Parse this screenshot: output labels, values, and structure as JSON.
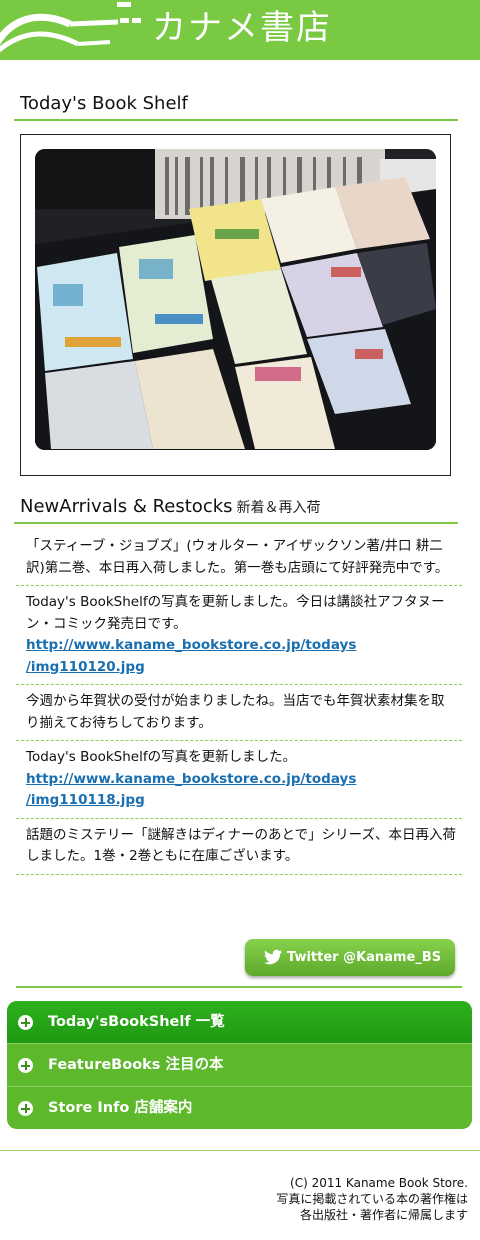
{
  "header": {
    "store_name": "カナメ書店",
    "logo_icon": "open-book-logo-icon",
    "brand_color": "#7ac943"
  },
  "todays_shelf": {
    "title": "Today's Book Shelf",
    "photo_icon": "book-shelf-photo"
  },
  "new_arrivals": {
    "title": "NewArrivals & Restocks",
    "subtitle": "新着＆再入荷",
    "items": [
      {
        "text": "「スティーブ・ジョブズ」(ウォルター・アイザックソン著/井口 耕二訳)第二巻、本日再入荷しました。第一巻も店頭にて好評発売中です。",
        "link1": "",
        "link2": ""
      },
      {
        "text": "Today's BookShelfの写真を更新しました。今日は講談社アフタヌーン・コミック発売日です。",
        "link1": "http://www.kaname_bookstore.co.jp/todays",
        "link2": "/img110120.jpg"
      },
      {
        "text": "今週から年賀状の受付が始まりましたね。当店でも年賀状素材集を取り揃えてお待ちしております。",
        "link1": "",
        "link2": ""
      },
      {
        "text": "Today's BookShelfの写真を更新しました。",
        "link1": "http://www.kaname_bookstore.co.jp/todays",
        "link2": "/img110118.jpg"
      },
      {
        "text": "話題のミステリー「謎解きはディナーのあとで」シリーズ、本日再入荷しました。1巻・2巻ともに在庫ございます。",
        "link1": "",
        "link2": ""
      }
    ],
    "link_color": "#1a6fb0"
  },
  "twitter": {
    "label": "Twitter @Kaname_BS",
    "icon": "twitter-bird-icon"
  },
  "menu": {
    "items": [
      {
        "label": "Today'sBookShelf 一覧",
        "icon": "plus-circle-icon"
      },
      {
        "label": "FeatureBooks 注目の本",
        "icon": "plus-circle-icon"
      },
      {
        "label": "Store Info 店舗案内",
        "icon": "plus-circle-icon"
      }
    ]
  },
  "footer": {
    "copyright": "(C) 2011 Kaname Book Store.",
    "note1": "写真に掲載されている本の著作権は",
    "note2": "各出版社・著作者に帰属します"
  }
}
